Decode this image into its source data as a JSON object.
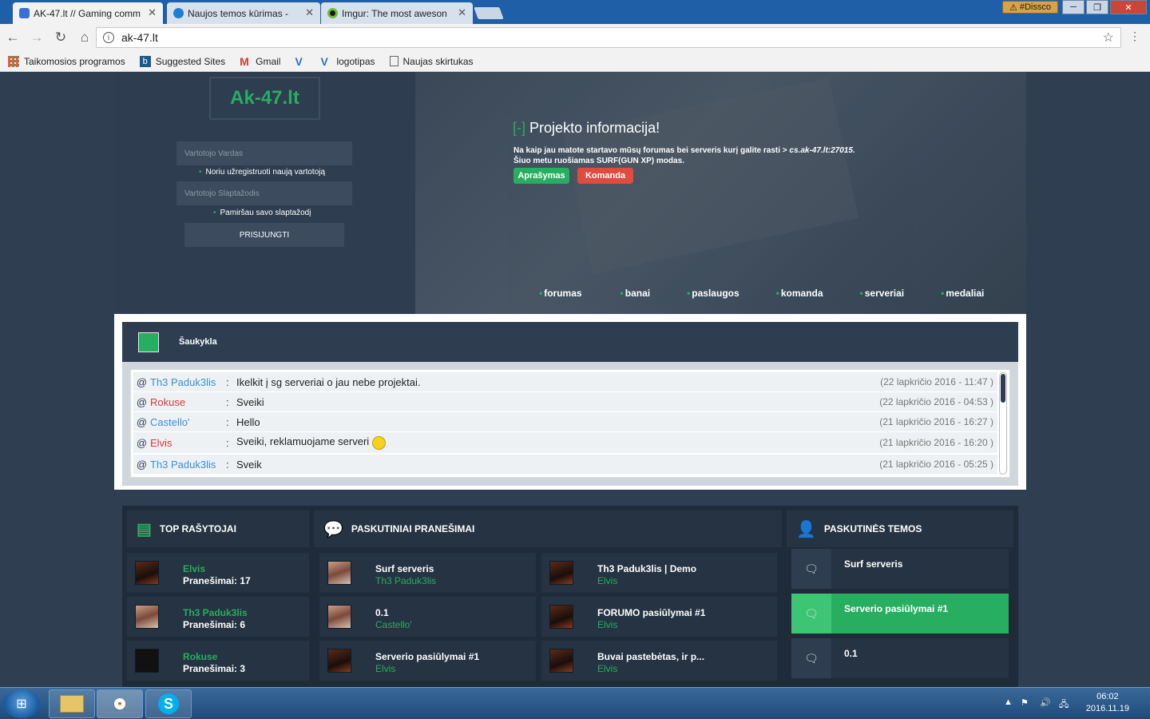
{
  "browser": {
    "tabs": [
      {
        "title": "AK-47.lt // Gaming comm",
        "active": true
      },
      {
        "title": "Naujos temos kūrimas - ",
        "active": false
      },
      {
        "title": "Imgur: The most aweson",
        "active": false
      }
    ],
    "url": "ak-47.lt",
    "profile_badge": "#Dissco",
    "bookmarks": [
      "Taikomosios programos",
      "Suggested Sites",
      "Gmail",
      "",
      "logotipas",
      "Naujas skirtukas"
    ]
  },
  "site": {
    "logo": "Ak-47.lt",
    "login": {
      "username_placeholder": "Vartotojo Vardas",
      "register_link": "Noriu užregistruoti naują vartotoją",
      "password_placeholder": "Vartotojo Slaptažodis",
      "forgot_link": "Pamiršau savo slaptažodį",
      "submit": "PRISIJUNGTI"
    },
    "info": {
      "bracket_left": "[",
      "bracket_mid": "-",
      "bracket_right": "]",
      "title": "Projekto informacija!",
      "text_prefix": "Na kaip jau matote startavo mūsų forumas bei serveris kurį galite rasti > ",
      "server": "cs.ak-47.lt:27015.",
      "text_line2": "Šiuo metu ruošiamas SURF(GUN XP) modas.",
      "btn_desc": "Aprašymas",
      "btn_team": "Komanda"
    },
    "nav": [
      "forumas",
      "banai",
      "paslaugos",
      "komanda",
      "serveriai",
      "medaliai"
    ]
  },
  "shoutbox": {
    "title": "Šaukykla",
    "rows": [
      {
        "name": "Th3 Paduk3lis",
        "color": "#3a8fd6",
        "msg": "Ikelkit į sg serveriai o jau nebe projektai.",
        "time": "(22 lapkričio 2016 - 11:47 )"
      },
      {
        "name": "Rokuse",
        "color": "#d63a3a",
        "msg": "Sveiki",
        "time": "(22 lapkričio 2016 - 04:53 )"
      },
      {
        "name": "Castello'",
        "color": "#3a8fd6",
        "msg": "Hello",
        "time": "(21 lapkričio 2016 - 16:27 )"
      },
      {
        "name": "Elvis",
        "color": "#d63a3a",
        "msg": "Sveiki, reklamuojame serveri",
        "time": "(21 lapkričio 2016 - 16:20 )"
      },
      {
        "name": "Th3 Paduk3lis",
        "color": "#3a8fd6",
        "msg": "Sveik",
        "time": "(21 lapkričio 2016 - 05:25 )"
      }
    ]
  },
  "panels": {
    "top_writers": {
      "title": "TOP RAŠYTOJAI",
      "items": [
        {
          "name": "Elvis",
          "posts": "Pranešimai: 17"
        },
        {
          "name": "Th3 Paduk3lis",
          "posts": "Pranešimai: 6"
        },
        {
          "name": "Rokuse",
          "posts": "Pranešimai: 3"
        }
      ]
    },
    "latest_posts": {
      "title": "PASKUTINIAI PRANEŠIMAI",
      "items": [
        {
          "title": "Surf serveris",
          "author": "Th3 Paduk3lis"
        },
        {
          "title": "Th3 Paduk3lis | Demo",
          "author": "Elvis"
        },
        {
          "title": "0.1",
          "author": "Castello'"
        },
        {
          "title": "FORUMO pasiūlymai #1",
          "author": "Elvis"
        },
        {
          "title": "Serverio pasiūlymai #1",
          "author": "Elvis"
        },
        {
          "title": "Buvai pastebėtas, ir p...",
          "author": "Elvis"
        }
      ]
    },
    "latest_topics": {
      "title": "PASKUTINĖS TEMOS",
      "items": [
        "Surf serveris",
        "Serverio pasiūlymai #1",
        "0.1"
      ]
    }
  },
  "taskbar": {
    "time": "06:02",
    "date": "2016.11.19"
  }
}
